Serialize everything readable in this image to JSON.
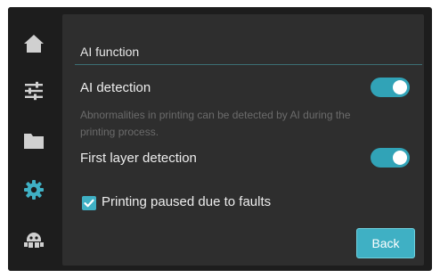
{
  "sidebar": {
    "items": [
      {
        "icon": "home-icon"
      },
      {
        "icon": "sliders-icon"
      },
      {
        "icon": "folder-icon"
      },
      {
        "icon": "gear-icon",
        "active": true
      },
      {
        "icon": "robot-icon"
      }
    ]
  },
  "colors": {
    "accent": "#3fb0c4",
    "icon": "#d0d0d0",
    "panel": "#2e2e2e",
    "background": "#1d1d1d"
  },
  "section": {
    "title": "AI function"
  },
  "ai_detection": {
    "label": "AI detection",
    "description": "Abnormalities in printing can be detected by AI during the printing process.",
    "enabled": true
  },
  "first_layer": {
    "label": "First layer detection",
    "enabled": true
  },
  "pause_on_fault": {
    "label": "Printing paused due to faults",
    "checked": true
  },
  "back_button": {
    "label": "Back"
  }
}
